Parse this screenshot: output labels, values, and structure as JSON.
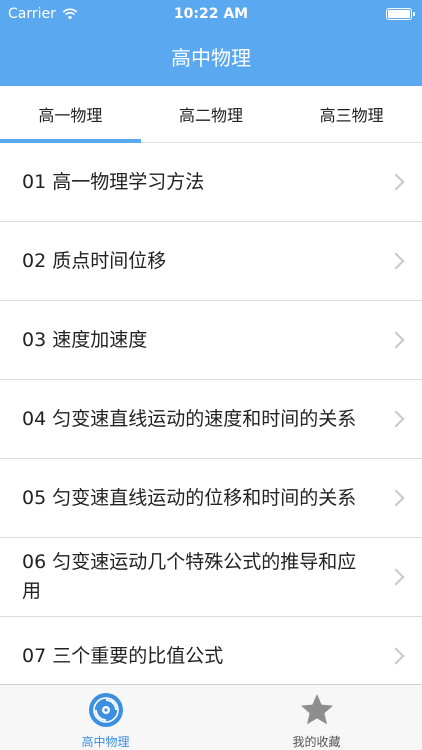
{
  "status_bar": {
    "carrier": "Carrier",
    "time": "10:22 AM"
  },
  "nav": {
    "title": "高中物理"
  },
  "tabs": [
    {
      "label": "高一物理",
      "active": true
    },
    {
      "label": "高二物理",
      "active": false
    },
    {
      "label": "高三物理",
      "active": false
    }
  ],
  "list": [
    "01 高一物理学习方法",
    "02 质点时间位移",
    "03 速度加速度",
    "04 匀变速直线运动的速度和时间的关系",
    "05 匀变速直线运动的位移和时间的关系",
    "06 匀变速运动几个特殊公式的推导和应用",
    "07 三个重要的比值公式"
  ],
  "tabbar": {
    "home_label": "高中物理",
    "favorites_label": "我的收藏",
    "home_icon": "disc-icon",
    "favorites_icon": "star-icon"
  },
  "colors": {
    "accent": "#5aa8ef",
    "active_tab_text": "#3d8fe0",
    "star_gray": "#8e8e8e"
  }
}
